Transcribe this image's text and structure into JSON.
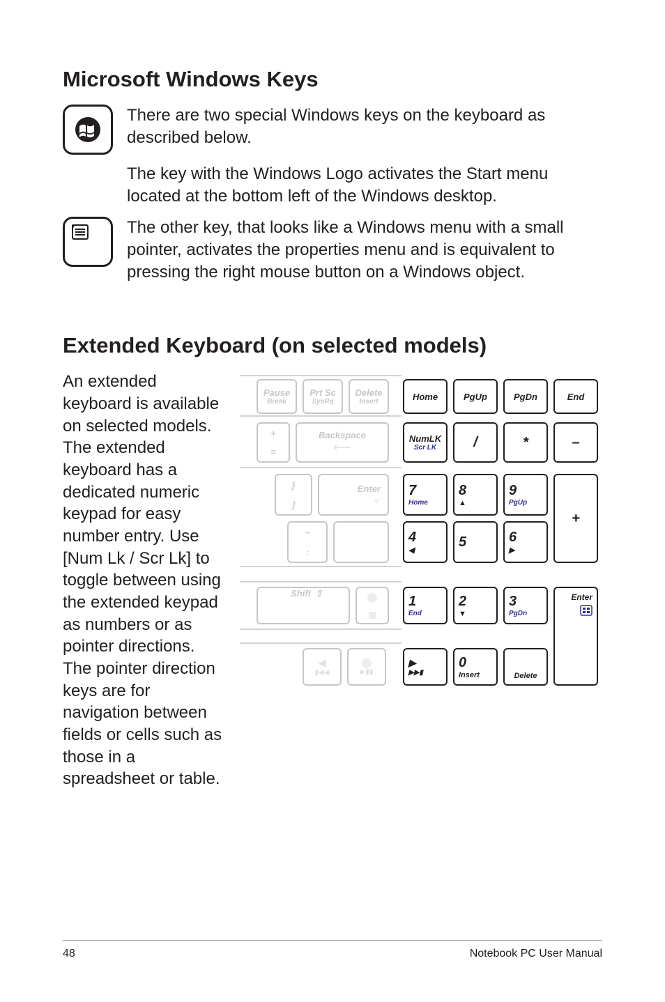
{
  "sections": {
    "winkeys": {
      "heading": "Microsoft Windows Keys",
      "p1": "There are two special Windows keys on the keyboard as described below.",
      "p2": "The key with the Windows Logo activates the Start menu located at the bottom left of the Windows desktop.",
      "p3": "The other key, that looks like a Windows menu with a small pointer, activates the properties menu and is equivalent to pressing the right mouse button on a Windows object."
    },
    "extkb": {
      "heading": "Extended Keyboard (on selected models)",
      "p1": "An extended keyboard is available on selected models. The extended keyboard has a dedicated numeric keypad for easy number entry. Use [Num Lk / Scr Lk] to toggle between using the extended keypad as numbers or as pointer directions. The pointer direction keys are for navigation between fields or cells such as those in a spreadsheet or table."
    }
  },
  "keypad": {
    "grey": {
      "pause": {
        "top": "Pause",
        "bot": "Break"
      },
      "prtsc": {
        "top": "Prt Sc",
        "bot": "SysRq"
      },
      "delete": {
        "top": "Delete",
        "bot": "Insert"
      },
      "backspace": "Backspace",
      "enter": "Enter",
      "shift": "Shift",
      "brace": "}",
      "bracket": "]",
      "tilde": "~",
      "plus": "+",
      "eq": "="
    },
    "row1": {
      "home": "Home",
      "pgup": "PgUp",
      "pgdn": "PgDn",
      "end": "End"
    },
    "row2": {
      "numlk1": "NumLK",
      "numlk2": "Scr LK",
      "slash": "/",
      "star": "*",
      "minus": "–"
    },
    "row3": {
      "n7": "7",
      "n7s": "Home",
      "n8": "8",
      "n9": "9",
      "n9s": "PgUp"
    },
    "row4": {
      "n4": "4",
      "n5": "5",
      "n6": "6",
      "plus": "+"
    },
    "row5": {
      "n1": "1",
      "n1s": "End",
      "n2": "2",
      "n3": "3",
      "n3s": "PgDn"
    },
    "row6": {
      "ins": "0",
      "ins2": "Insert",
      "del": "Delete",
      "enter": "Enter"
    }
  },
  "footer": {
    "page": "48",
    "manual": "Notebook PC User Manual"
  }
}
